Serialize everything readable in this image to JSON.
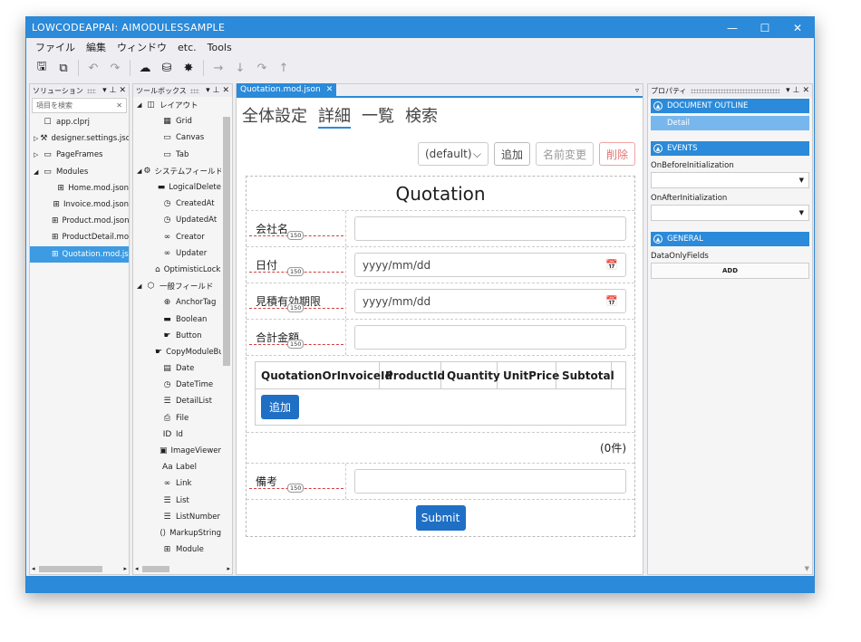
{
  "window": {
    "title": "LOWCODEAPPAI: AIMODULESSAMPLE",
    "controls": [
      "—",
      "☐",
      "✕"
    ]
  },
  "menu": [
    "ファイル",
    "編集",
    "ウィンドウ",
    "etc.",
    "Tools"
  ],
  "solution": {
    "title": "ソリューション",
    "search_placeholder": "項目を検索",
    "items": [
      {
        "label": "app.clprj",
        "icon": "☐",
        "arrow": "",
        "indent": 0
      },
      {
        "label": "designer.settings.json",
        "icon": "⚒",
        "arrow": "▷",
        "indent": 0
      },
      {
        "label": "PageFrames",
        "icon": "▭",
        "arrow": "▷",
        "indent": 0
      },
      {
        "label": "Modules",
        "icon": "▭",
        "arrow": "◢",
        "indent": 0
      },
      {
        "label": "Home.mod.json",
        "icon": "⊞",
        "arrow": "",
        "indent": 1
      },
      {
        "label": "Invoice.mod.json",
        "icon": "⊞",
        "arrow": "",
        "indent": 1
      },
      {
        "label": "Product.mod.json",
        "icon": "⊞",
        "arrow": "",
        "indent": 1
      },
      {
        "label": "ProductDetail.mod.json",
        "icon": "⊞",
        "arrow": "",
        "indent": 1
      },
      {
        "label": "Quotation.mod.json",
        "icon": "⊞",
        "arrow": "",
        "indent": 1,
        "selected": true
      }
    ]
  },
  "toolbox": {
    "title": "ツールボックス",
    "items": [
      {
        "label": "レイアウト",
        "icon": "◫",
        "arrow": "◢",
        "indent": 0
      },
      {
        "label": "Grid",
        "icon": "▦",
        "arrow": "",
        "indent": 1
      },
      {
        "label": "Canvas",
        "icon": "▭",
        "arrow": "",
        "indent": 1
      },
      {
        "label": "Tab",
        "icon": "▭",
        "arrow": "",
        "indent": 1
      },
      {
        "label": "システムフィールド",
        "icon": "⚙",
        "arrow": "◢",
        "indent": 0
      },
      {
        "label": "LogicalDelete",
        "icon": "▬",
        "arrow": "",
        "indent": 1
      },
      {
        "label": "CreatedAt",
        "icon": "◷",
        "arrow": "",
        "indent": 1
      },
      {
        "label": "UpdatedAt",
        "icon": "◷",
        "arrow": "",
        "indent": 1
      },
      {
        "label": "Creator",
        "icon": "∞",
        "arrow": "",
        "indent": 1
      },
      {
        "label": "Updater",
        "icon": "∞",
        "arrow": "",
        "indent": 1
      },
      {
        "label": "OptimisticLocking",
        "icon": "⌂",
        "arrow": "",
        "indent": 1
      },
      {
        "label": "一般フィールド",
        "icon": "⬡",
        "arrow": "◢",
        "indent": 0
      },
      {
        "label": "AnchorTag",
        "icon": "⊕",
        "arrow": "",
        "indent": 1
      },
      {
        "label": "Boolean",
        "icon": "▬",
        "arrow": "",
        "indent": 1
      },
      {
        "label": "Button",
        "icon": "☛",
        "arrow": "",
        "indent": 1
      },
      {
        "label": "CopyModuleButton",
        "icon": "☛",
        "arrow": "",
        "indent": 1
      },
      {
        "label": "Date",
        "icon": "▤",
        "arrow": "",
        "indent": 1
      },
      {
        "label": "DateTime",
        "icon": "◷",
        "arrow": "",
        "indent": 1
      },
      {
        "label": "DetailList",
        "icon": "☰",
        "arrow": "",
        "indent": 1
      },
      {
        "label": "File",
        "icon": "⎙",
        "arrow": "",
        "indent": 1
      },
      {
        "label": "Id",
        "icon": "ID",
        "arrow": "",
        "indent": 1
      },
      {
        "label": "ImageViewer",
        "icon": "▣",
        "arrow": "",
        "indent": 1
      },
      {
        "label": "Label",
        "icon": "Aa",
        "arrow": "",
        "indent": 1
      },
      {
        "label": "Link",
        "icon": "∞",
        "arrow": "",
        "indent": 1
      },
      {
        "label": "List",
        "icon": "☰",
        "arrow": "",
        "indent": 1
      },
      {
        "label": "ListNumber",
        "icon": "☰",
        "arrow": "",
        "indent": 1
      },
      {
        "label": "MarkupString",
        "icon": "⟨⟩",
        "arrow": "",
        "indent": 1
      },
      {
        "label": "Module",
        "icon": "⊞",
        "arrow": "",
        "indent": 1
      }
    ]
  },
  "doc": {
    "tab": "Quotation.mod.json",
    "design_tabs": [
      {
        "label": "全体設定",
        "active": false
      },
      {
        "label": "詳細",
        "active": true
      },
      {
        "label": "一覧",
        "active": false
      },
      {
        "label": "検索",
        "active": false
      }
    ],
    "top_select": "(default)",
    "btn_add": "追加",
    "btn_rename": "名前変更",
    "btn_delete": "削除",
    "form_title": "Quotation",
    "fields": [
      {
        "label": "会社名",
        "width_badge": "150",
        "value": "",
        "calendar": false
      },
      {
        "label": "日付",
        "width_badge": "150",
        "value": "yyyy/mm/dd",
        "calendar": true
      },
      {
        "label": "見積有効期限",
        "width_badge": "150",
        "value": "yyyy/mm/dd",
        "calendar": true
      },
      {
        "label": "合計金額",
        "width_badge": "150",
        "value": "",
        "calendar": false
      }
    ],
    "table_columns": [
      "QuotationOrInvoiceId",
      "ProductId",
      "Quantity",
      "UnitPrice",
      "Subtotal"
    ],
    "table_add": "追加",
    "count": "(0件)",
    "note": {
      "label": "備考",
      "width_badge": "150"
    },
    "submit": "Submit"
  },
  "props": {
    "title": "プロパティ",
    "sections": {
      "outline": "DOCUMENT OUTLINE",
      "outline_item": "Detail",
      "events": "EVENTS",
      "event1": "OnBeforeInitialization",
      "event2": "OnAfterInitialization",
      "general": "GENERAL",
      "general_field": "DataOnlyFields",
      "add": "ADD"
    }
  }
}
